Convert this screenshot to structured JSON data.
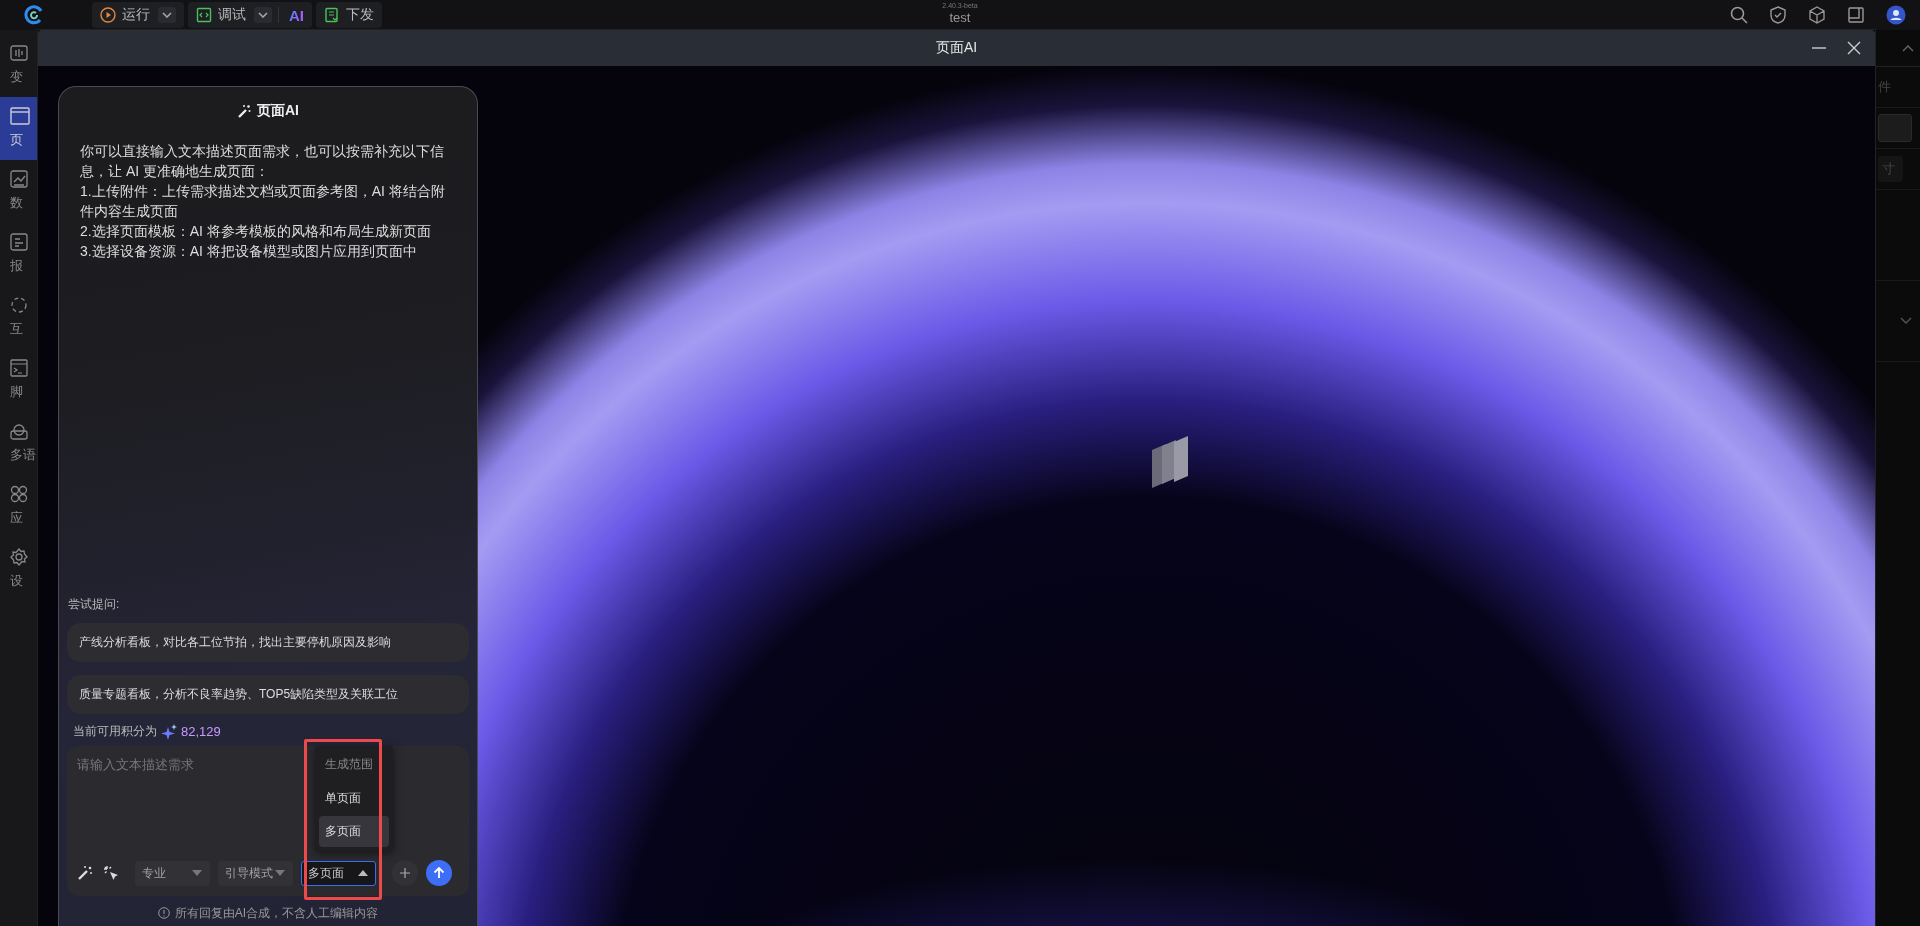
{
  "topbar": {
    "run": {
      "label": "运行"
    },
    "debug": {
      "label": "调试"
    },
    "ai_badge": "AI",
    "deploy": {
      "label": "下发"
    },
    "version": "2.40.3-beta",
    "project": "test"
  },
  "sidebar": {
    "items": [
      {
        "label": "变",
        "selected": false,
        "kind": "variable"
      },
      {
        "label": "页",
        "selected": true,
        "kind": "page"
      },
      {
        "label": "数",
        "selected": false,
        "kind": "data"
      },
      {
        "label": "报",
        "selected": false,
        "kind": "alarm"
      },
      {
        "label": "互",
        "selected": false,
        "kind": "link"
      },
      {
        "label": "脚",
        "selected": false,
        "kind": "script"
      },
      {
        "label": "多语",
        "selected": false,
        "kind": "language"
      },
      {
        "label": "应",
        "selected": false,
        "kind": "apps"
      },
      {
        "label": "设",
        "selected": false,
        "kind": "settings"
      }
    ]
  },
  "right_panel": {
    "items": [
      "件",
      "寸"
    ]
  },
  "modal": {
    "title": "页面AI"
  },
  "chat": {
    "title": "页面AI",
    "intro": "你可以直接输入文本描述页面需求，也可以按需补充以下信息，让 AI 更准确地生成页面：",
    "tips": [
      "1.上传附件：上传需求描述文档或页面参考图，AI 将结合附件内容生成页面",
      "2.选择页面模板：AI 将参考模板的风格和布局生成新页面",
      "3.选择设备资源：AI 将把设备模型或图片应用到页面中"
    ],
    "suggest_label": "尝试提问:",
    "suggestions": [
      "产线分析看板，对比各工位节拍，找出主要停机原因及影响",
      "质量专题看板，分析不良率趋势、TOP5缺陷类型及关联工位"
    ],
    "credits_label": "当前可用积分为",
    "credits": "82,129",
    "input": {
      "placeholder": "请输入文本描述需求"
    },
    "selects": [
      {
        "value": "专业",
        "open": false
      },
      {
        "value": "引导模式",
        "open": false
      },
      {
        "value": "多页面",
        "open": true
      }
    ],
    "menu": {
      "header": "生成范围",
      "options": [
        {
          "label": "单页面",
          "selected": false
        },
        {
          "label": "多页面",
          "selected": true
        }
      ]
    },
    "highlight": true,
    "footer": "所有回复由AI合成，不含人工编辑内容"
  }
}
